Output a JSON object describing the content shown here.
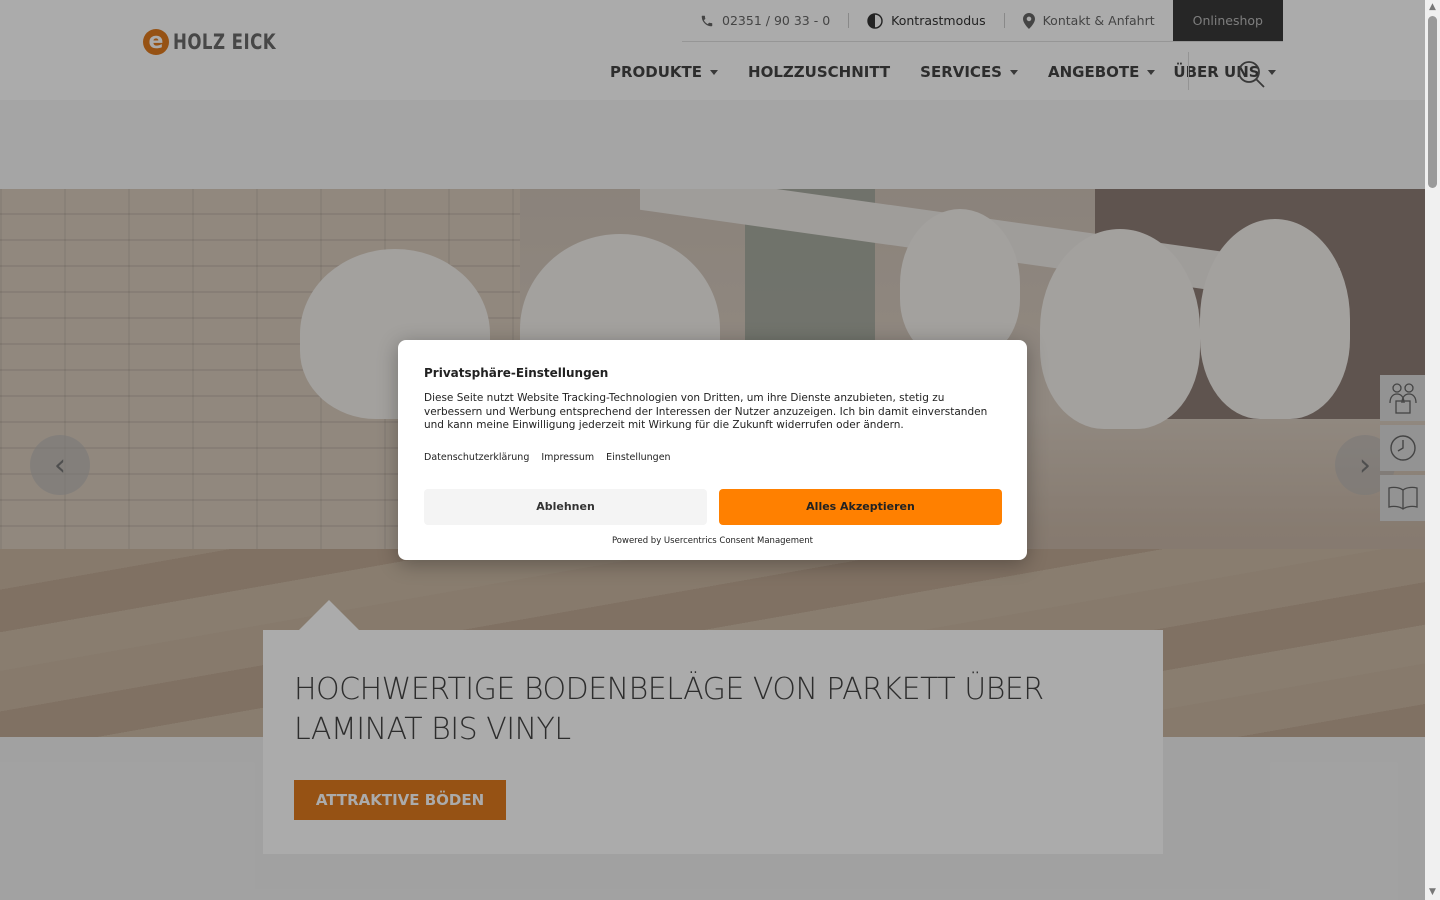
{
  "brand": {
    "mark": "e",
    "name": "HOLZ EICK",
    "accent": "#e07b1f"
  },
  "topbar": {
    "phone": "02351 / 90 33 - 0",
    "contrast": "Kontrastmodus",
    "contact": "Kontakt & Anfahrt",
    "shop": "Onlineshop"
  },
  "nav": {
    "items": [
      {
        "label": "PRODUKTE"
      },
      {
        "label": "HOLZZUSCHNITT"
      },
      {
        "label": "SERVICES"
      },
      {
        "label": "ANGEBOTE"
      },
      {
        "label": "ÜBER UNS"
      }
    ]
  },
  "hero": {
    "title": "HOCHWERTIGE BODENBELÄGE VON PARKETT ÜBER LAMINAT BIS VINYL",
    "cta": "ATTRAKTIVE BÖDEN",
    "prev_icon": "chevron-left-icon",
    "next_icon": "chevron-right-icon"
  },
  "side_tabs": [
    "team-icon",
    "clock-icon",
    "book-icon"
  ],
  "consent": {
    "title": "Privatsphäre-Einstellungen",
    "text": "Diese Seite nutzt Website Tracking-Technologien von Dritten, um ihre Dienste anzubieten, stetig zu verbessern und Werbung entsprechend der Interessen der Nutzer anzuzeigen. Ich bin damit einverstanden und kann meine Einwilligung jederzeit mit Wirkung für die Zukunft widerrufen oder ändern.",
    "links": [
      "Datenschutzerklärung",
      "Impressum",
      "Einstellungen"
    ],
    "deny": "Ablehnen",
    "accept": "Alles Akzeptieren",
    "accept_color": "#ff8000",
    "powered": "Powered by Usercentrics Consent Management"
  }
}
